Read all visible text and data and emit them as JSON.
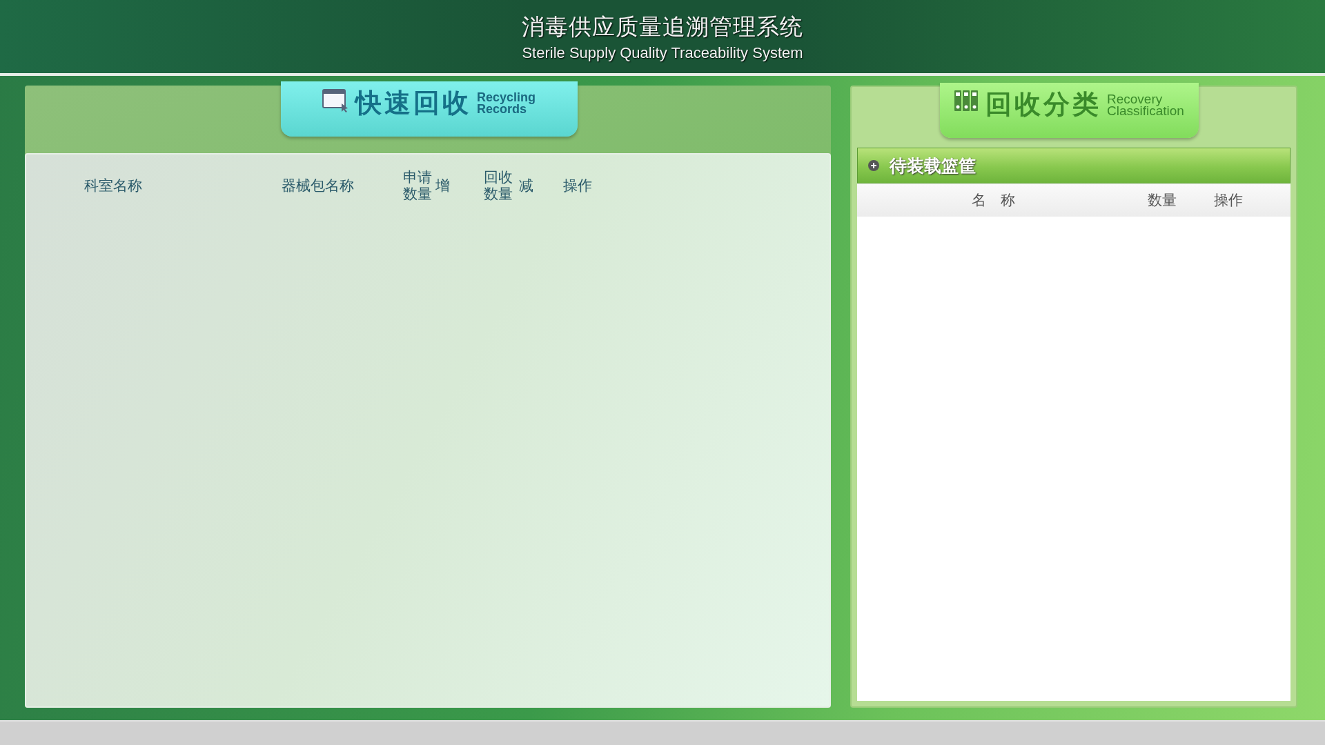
{
  "header": {
    "title": "消毒供应质量追溯管理系统",
    "subtitle": "Sterile Supply Quality Traceability System"
  },
  "recycling_panel": {
    "tab": {
      "title": "快速回收",
      "subtitle_line1": "Recycling",
      "subtitle_line2": "Records"
    },
    "columns": [
      {
        "label": "科室名称",
        "kind": "text"
      },
      {
        "label": "器械包名称",
        "kind": "text"
      },
      {
        "label": "申请数量",
        "kind": "stacked"
      },
      {
        "label": "增",
        "kind": "text"
      },
      {
        "label": "回收数量",
        "kind": "stacked"
      },
      {
        "label": "减",
        "kind": "text"
      },
      {
        "label": "操作",
        "kind": "text"
      }
    ]
  },
  "classification_panel": {
    "tab": {
      "title": "回收分类",
      "subtitle_line1": "Recovery",
      "subtitle_line2": "Classification"
    },
    "group": {
      "title": "待装载篮筐",
      "expanded": false
    },
    "columns": [
      "名　称",
      "数量",
      "操作"
    ]
  }
}
